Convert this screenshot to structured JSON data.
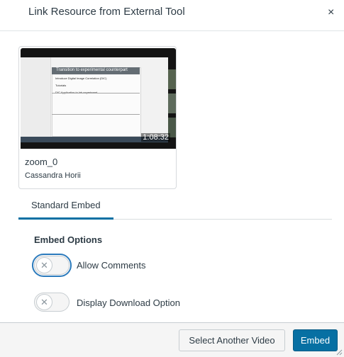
{
  "header": {
    "title": "Link Resource from External Tool",
    "close_icon": "close-icon",
    "close_glyph": "×"
  },
  "video": {
    "name": "zoom_0",
    "owner": "Cassandra Horii",
    "duration": "1:08:32",
    "thumbnail_slide_title": "Transition to experimental counterpart",
    "thumbnail_slide_lines": [
      "Introduce Digital Image Correlation (DIC)",
      "Tutorials",
      "DIC Application to lab experiment"
    ]
  },
  "tabs": [
    {
      "label": "Standard Embed",
      "selected": true
    }
  ],
  "embed_options": {
    "heading": "Embed Options",
    "options": [
      {
        "label": "Allow Comments",
        "enabled": false,
        "focused": true
      },
      {
        "label": "Display Download Option",
        "enabled": false,
        "focused": false
      }
    ],
    "toggle_glyph": "✕"
  },
  "footer": {
    "secondary_label": "Select Another Video",
    "primary_label": "Embed"
  },
  "colors": {
    "primary": "#0770a3",
    "text": "#2d3b45",
    "footer_bg": "#f5f5f5"
  }
}
